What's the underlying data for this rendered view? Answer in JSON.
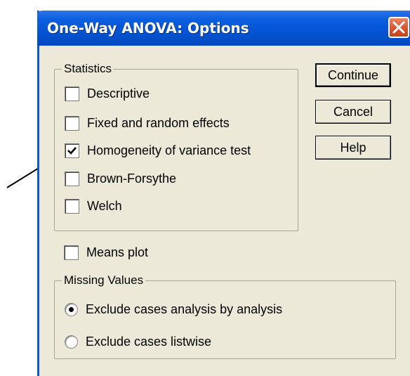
{
  "dialog": {
    "title": "One-Way ANOVA: Options",
    "close_icon": "close-x-icon"
  },
  "statistics": {
    "legend": "Statistics",
    "items": [
      {
        "label": "Descriptive",
        "checked": false
      },
      {
        "label": "Fixed and random effects",
        "checked": false
      },
      {
        "label": "Homogeneity of variance test",
        "checked": true
      },
      {
        "label": "Brown-Forsythe",
        "checked": false
      },
      {
        "label": "Welch",
        "checked": false
      }
    ]
  },
  "means_plot": {
    "label": "Means plot",
    "checked": false
  },
  "missing_values": {
    "legend": "Missing Values",
    "options": [
      {
        "label": "Exclude cases analysis by analysis",
        "selected": true
      },
      {
        "label": "Exclude cases listwise",
        "selected": false
      }
    ]
  },
  "buttons": {
    "continue": "Continue",
    "cancel": "Cancel",
    "help": "Help"
  },
  "annotation": {
    "pointer_icon": "arrow-pointer-icon"
  }
}
